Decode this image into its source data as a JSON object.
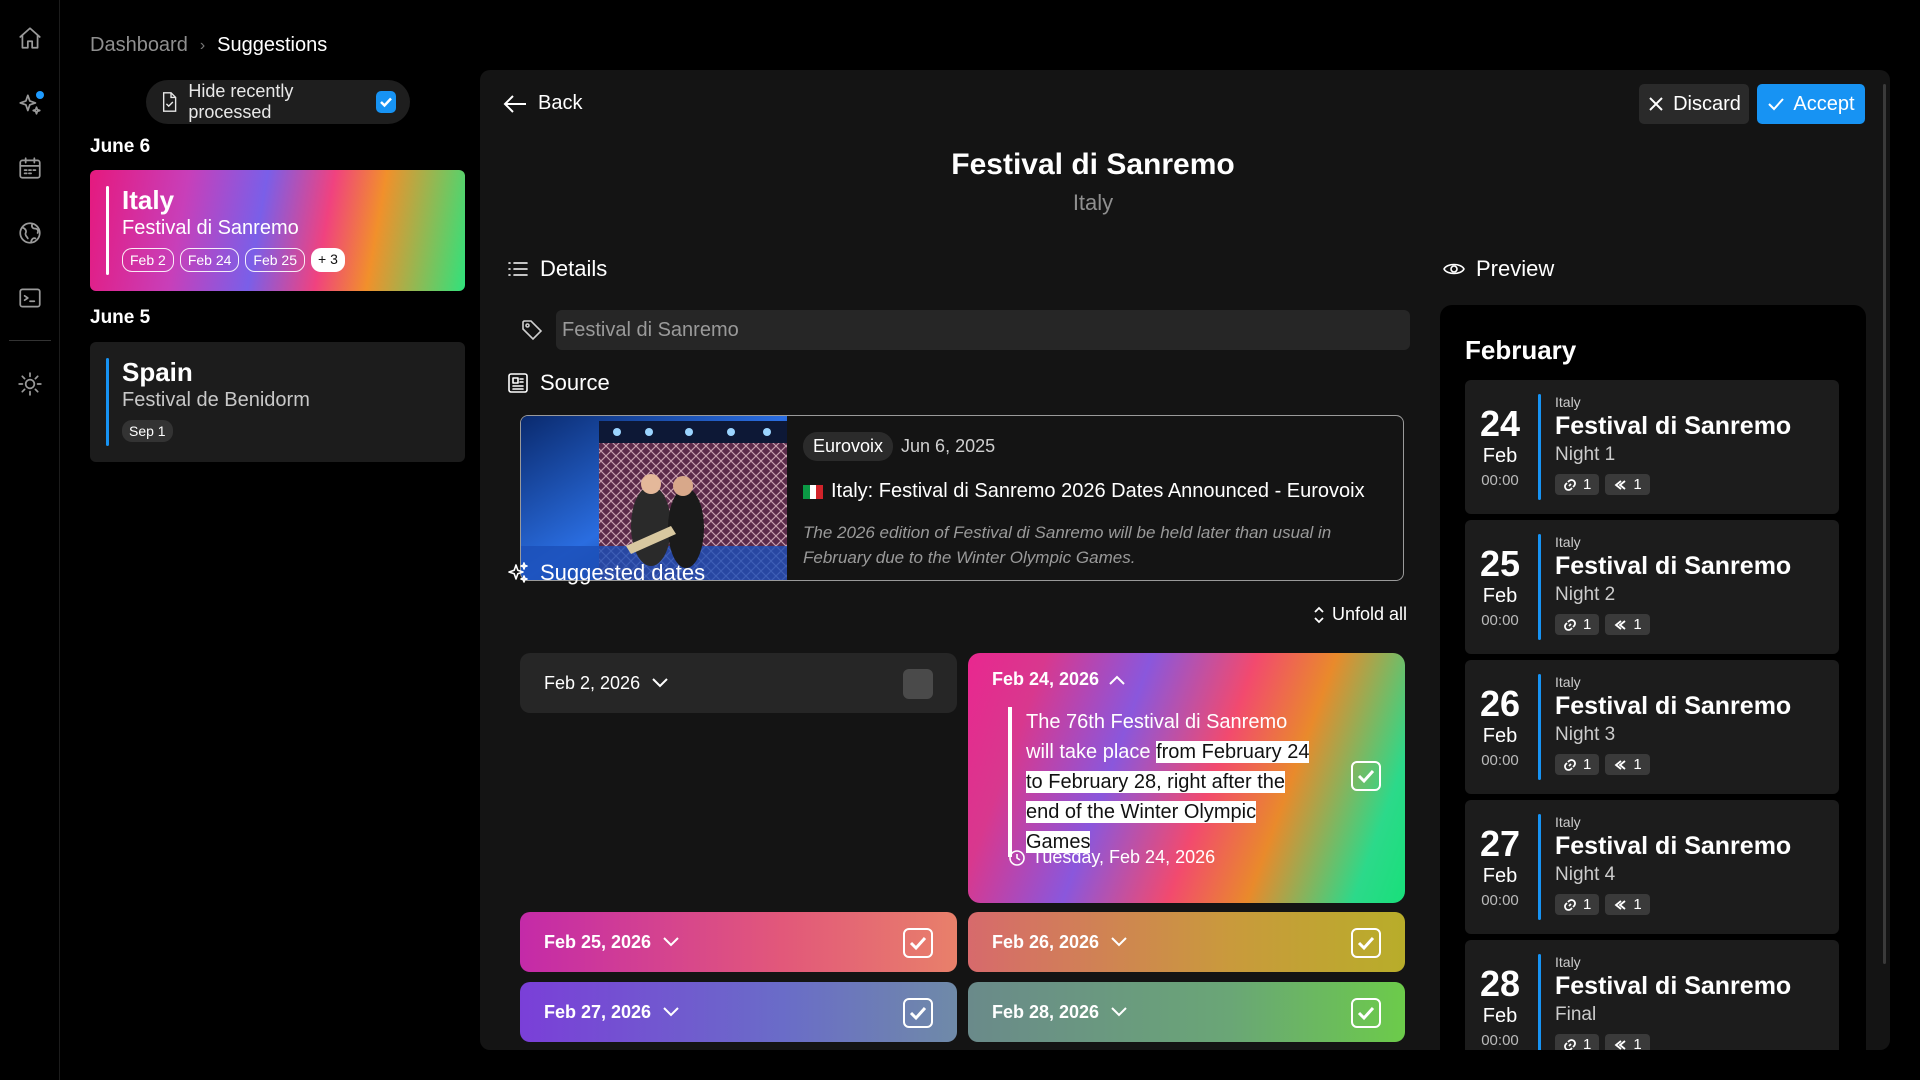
{
  "breadcrumb": {
    "dashboard": "Dashboard",
    "current": "Suggestions"
  },
  "filter": {
    "hide_recent_label": "Hide recently processed",
    "checked": true
  },
  "days": [
    {
      "label": "June 6"
    },
    {
      "label": "June 5"
    }
  ],
  "suggestions": [
    {
      "country": "Italy",
      "event": "Festival di Sanremo",
      "chips": [
        "Feb 2",
        "Feb 24",
        "Feb 25"
      ],
      "more": "+ 3"
    },
    {
      "country": "Spain",
      "event": "Festival de Benidorm",
      "chips": [
        "Sep 1"
      ]
    }
  ],
  "detail": {
    "back_label": "Back",
    "discard_label": "Discard",
    "accept_label": "Accept",
    "title": "Festival di Sanremo",
    "subtitle": "Italy",
    "details_heading": "Details",
    "name_value": "Festival di Sanremo",
    "source_heading": "Source",
    "source": {
      "publisher": "Eurovoix",
      "date": "Jun 6, 2025",
      "title": "Italy: Festival di Sanremo 2026 Dates Announced - Eurovoix",
      "description": "The 2026 edition of Festival di Sanremo will be held later than usual in February due to the Winter Olympic Games."
    },
    "suggested_heading": "Suggested dates",
    "unfold_label": "Unfold all",
    "dates": [
      {
        "label": "Feb 2, 2026",
        "checked": false
      },
      {
        "label": "Feb 24, 2026",
        "checked": true
      },
      {
        "label": "Feb 25, 2026",
        "checked": true
      },
      {
        "label": "Feb 26, 2026",
        "checked": true
      },
      {
        "label": "Feb 27, 2026",
        "checked": true
      },
      {
        "label": "Feb 28, 2026",
        "checked": true
      }
    ],
    "expanded": {
      "quote_plain": "The 76th Festival di Sanremo will take place ",
      "quote_highlight": "from February 24 to February 28, right after the end of the Winter Olympic Games",
      "when": "Tuesday, Feb 24, 2026"
    },
    "preview_heading": "Preview",
    "preview": {
      "month": "February",
      "items": [
        {
          "day": "24",
          "mon": "Feb",
          "time": "00:00",
          "country": "Italy",
          "title": "Festival di Sanremo",
          "sub": "Night 1",
          "links": "1",
          "sources": "1"
        },
        {
          "day": "25",
          "mon": "Feb",
          "time": "00:00",
          "country": "Italy",
          "title": "Festival di Sanremo",
          "sub": "Night 2",
          "links": "1",
          "sources": "1"
        },
        {
          "day": "26",
          "mon": "Feb",
          "time": "00:00",
          "country": "Italy",
          "title": "Festival di Sanremo",
          "sub": "Night 3",
          "links": "1",
          "sources": "1"
        },
        {
          "day": "27",
          "mon": "Feb",
          "time": "00:00",
          "country": "Italy",
          "title": "Festival di Sanremo",
          "sub": "Night 4",
          "links": "1",
          "sources": "1"
        },
        {
          "day": "28",
          "mon": "Feb",
          "time": "00:00",
          "country": "Italy",
          "title": "Festival di Sanremo",
          "sub": "Final",
          "links": "1",
          "sources": "1"
        }
      ]
    }
  },
  "colors": {
    "accent": "#1793f3",
    "panel": "#141414",
    "card": "#1c1c1c"
  }
}
